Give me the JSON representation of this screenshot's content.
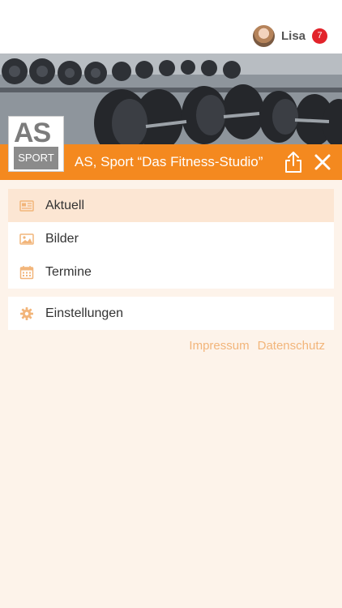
{
  "user": {
    "name": "Lisa",
    "notification_count": "7"
  },
  "header": {
    "logo_top": "AS",
    "logo_bottom": "SPORT",
    "title": "AS, Sport “Das Fitness-Studio”",
    "share_icon": "share-icon",
    "close_icon": "close-icon"
  },
  "menu": {
    "main_items": [
      {
        "label": "Aktuell",
        "icon": "news-icon",
        "active": true
      },
      {
        "label": "Bilder",
        "icon": "image-icon",
        "active": false
      },
      {
        "label": "Termine",
        "icon": "calendar-icon",
        "active": false
      }
    ],
    "settings_item": {
      "label": "Einstellungen",
      "icon": "gear-icon"
    }
  },
  "footer": {
    "impressum": "Impressum",
    "datenschutz": "Datenschutz"
  },
  "colors": {
    "accent": "#f4891f",
    "background": "#fdf3ea",
    "active_row": "#fce6d3",
    "link": "#f2b57a",
    "badge": "#e2232a"
  }
}
